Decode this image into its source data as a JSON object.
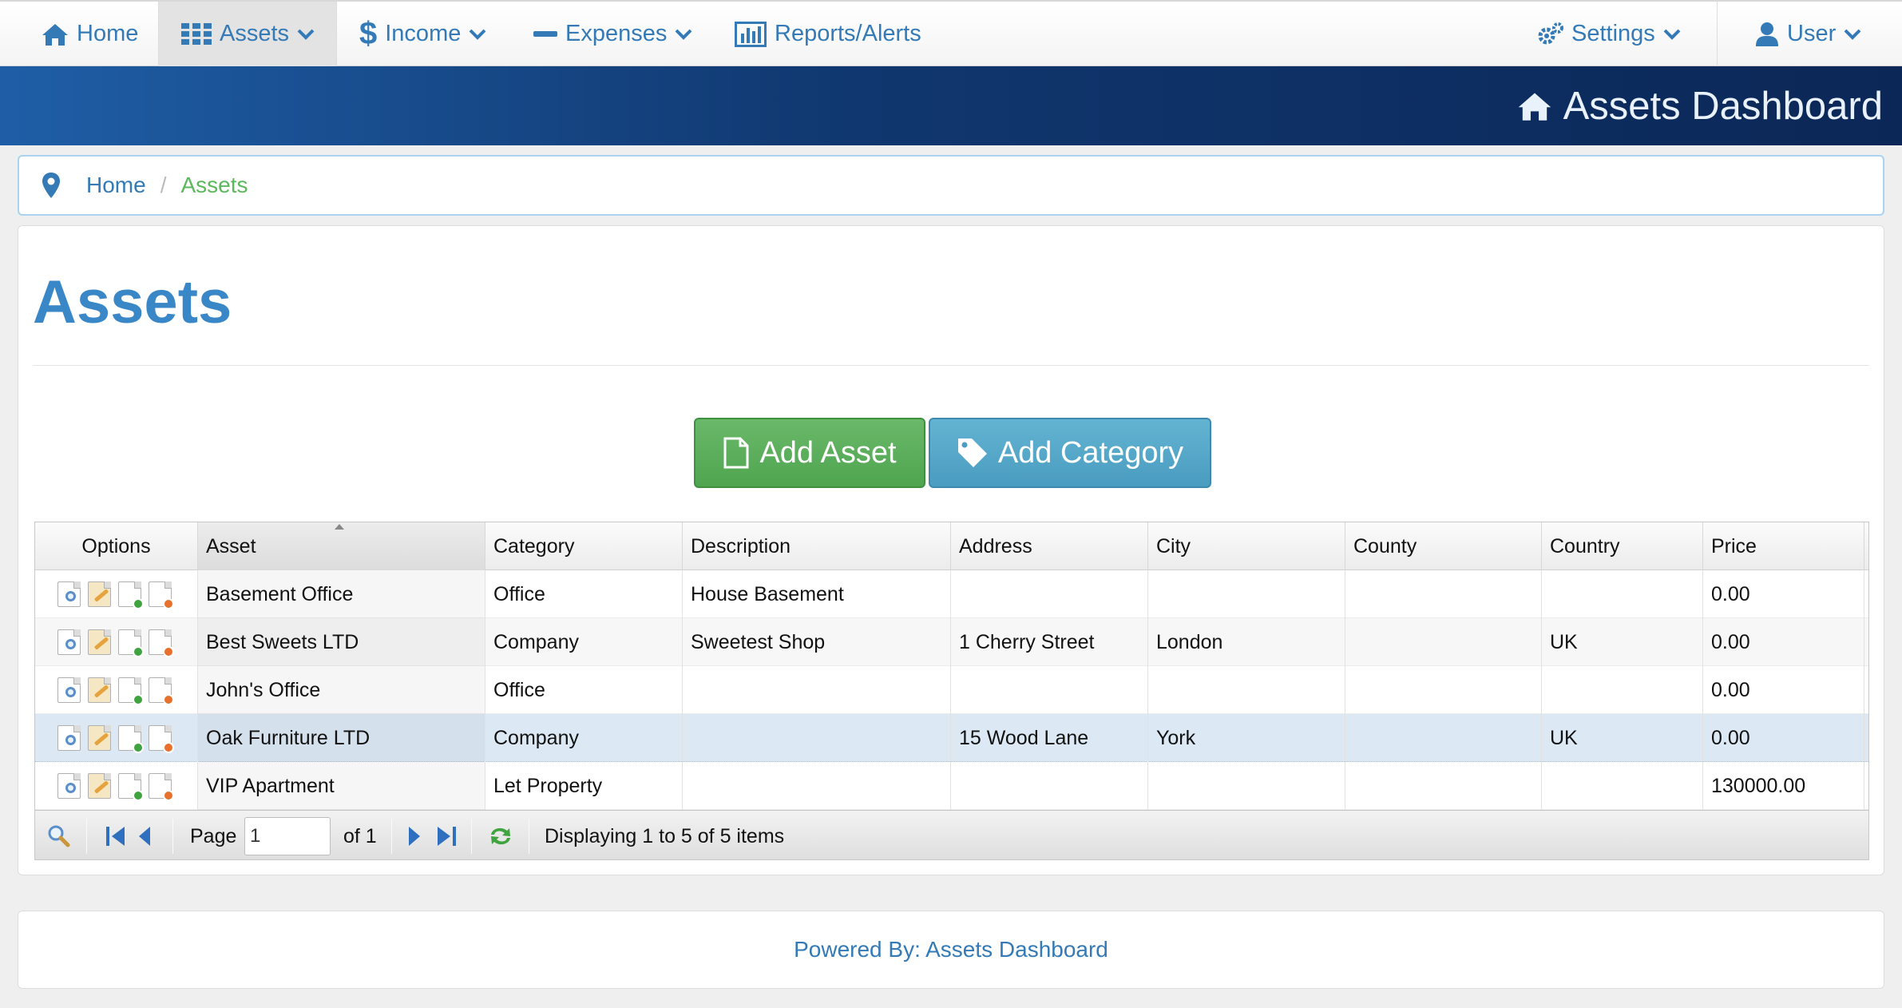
{
  "nav": {
    "home": "Home",
    "assets": "Assets",
    "income": "Income",
    "expenses": "Expenses",
    "reports": "Reports/Alerts",
    "settings": "Settings",
    "user": "User"
  },
  "banner": {
    "title": "Assets Dashboard"
  },
  "breadcrumb": {
    "home": "Home",
    "separator": "/",
    "current": "Assets"
  },
  "page": {
    "title": "Assets"
  },
  "actions": {
    "add_asset": "Add Asset",
    "add_category": "Add Category"
  },
  "grid": {
    "columns": [
      "Options",
      "Asset",
      "Category",
      "Description",
      "Address",
      "City",
      "County",
      "Country",
      "Price"
    ],
    "sorted_column": "Asset",
    "selected_row": 3,
    "rows": [
      {
        "asset": "Basement Office",
        "category": "Office",
        "description": "House Basement",
        "address": "",
        "city": "",
        "county": "",
        "country": "",
        "price": "0.00"
      },
      {
        "asset": "Best Sweets LTD",
        "category": "Company",
        "description": "Sweetest Shop",
        "address": "1 Cherry Street",
        "city": "London",
        "county": "",
        "country": "UK",
        "price": "0.00"
      },
      {
        "asset": "John's Office",
        "category": "Office",
        "description": "",
        "address": "",
        "city": "",
        "county": "",
        "country": "",
        "price": "0.00"
      },
      {
        "asset": "Oak Furniture LTD",
        "category": "Company",
        "description": "",
        "address": "15 Wood Lane",
        "city": "York",
        "county": "",
        "country": "UK",
        "price": "0.00"
      },
      {
        "asset": "VIP Apartment",
        "category": "Let Property",
        "description": "",
        "address": "",
        "city": "",
        "county": "",
        "country": "",
        "price": "130000.00"
      }
    ]
  },
  "pager": {
    "page_label": "Page",
    "page_value": "1",
    "of_label": "of 1",
    "display_text": "Displaying 1 to 5 of 5 items"
  },
  "footer": {
    "text": "Powered By: Assets Dashboard"
  },
  "colors": {
    "link": "#337ab7",
    "title": "#3a87c8",
    "success": "#5cb85c",
    "info": "#5bc0de",
    "banner_dark": "#0b2757"
  }
}
